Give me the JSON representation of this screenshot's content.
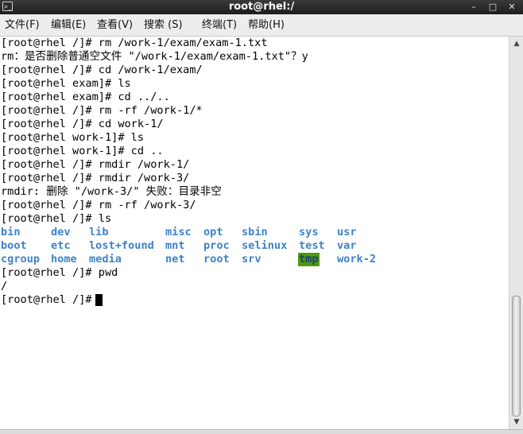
{
  "window": {
    "title": "root@rhel:/",
    "icon": "terminal-icon",
    "controls": {
      "minimize": "–",
      "maximize": "□",
      "close": "✕"
    }
  },
  "menu": [
    "文件(F)",
    "编辑(E)",
    "查看(V)",
    "搜索 (S)",
    "终端(T)",
    "帮助(H)"
  ],
  "terminal": {
    "lines": [
      "[root@rhel /]# rm /work-1/exam/exam-1.txt",
      "rm：是否删除普通空文件 \"/work-1/exam/exam-1.txt\"？y",
      "[root@rhel /]# cd /work-1/exam/",
      "[root@rhel exam]# ls",
      "[root@rhel exam]# cd ../..",
      "[root@rhel /]# rm -rf /work-1/*",
      "[root@rhel /]# cd work-1/",
      "[root@rhel work-1]# ls",
      "[root@rhel work-1]# cd ..",
      "[root@rhel /]# rmdir /work-1/",
      "[root@rhel /]# rmdir /work-3/",
      "rmdir: 删除 \"/work-3/\" 失败：目录非空",
      "[root@rhel /]# rm -rf /work-3/",
      "[root@rhel /]# ls"
    ],
    "ls_output": [
      [
        "bin",
        "dev",
        "lib",
        "misc",
        "opt",
        "sbin",
        "sys",
        "usr"
      ],
      [
        "boot",
        "etc",
        "lost+found",
        "mnt",
        "proc",
        "selinux",
        "test",
        "var"
      ],
      [
        "cgroup",
        "home",
        "media",
        "net",
        "root",
        "srv",
        "tmp",
        "work-2"
      ]
    ],
    "highlighted_entry": "tmp",
    "after_lines": [
      "[root@rhel /]# pwd",
      "/",
      "[root@rhel /]# "
    ],
    "colors": {
      "directory": "#3e82c8",
      "highlight_bg": "#4e9a06"
    }
  },
  "scrollbar": {
    "up_arrow": "▲",
    "down_arrow": "▼"
  }
}
